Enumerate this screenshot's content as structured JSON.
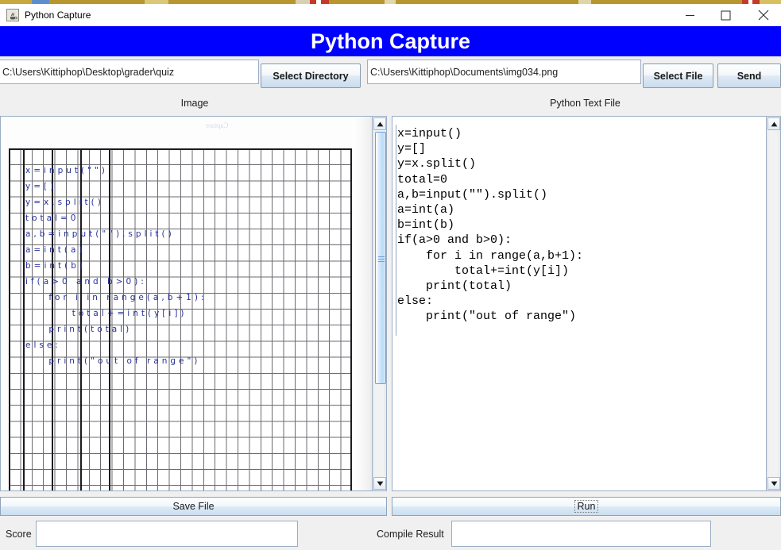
{
  "window": {
    "title": "Python Capture",
    "icon": "java-coffee-cup-icon",
    "controls": {
      "minimize": "—",
      "maximize": "□",
      "close": "✕"
    }
  },
  "banner": {
    "text": "Python Capture",
    "color": "#0000ff",
    "text_color": "#ffffff"
  },
  "toolbar": {
    "directory_path": "C:\\Users\\Kittiphop\\Desktop\\grader\\quiz",
    "select_directory_label": "Select Directory",
    "file_path": "C:\\Users\\Kittiphop\\Documents\\img034.png",
    "select_file_label": "Select File",
    "send_label": "Send"
  },
  "panels": {
    "image_caption": "Image",
    "python_caption": "Python Text File"
  },
  "image_panel": {
    "handwritten_lines": [
      "x=input(\"\")",
      "y=[]",
      "y=x.split()",
      "total=0",
      "a,b=input(\"\").split()",
      "a=int(a)",
      "b=int(b)",
      "if(a>0 and b>0):",
      "    for i in range(a,b+1):",
      "        total+=int(y[i])",
      "    print(total)",
      "else:",
      "    print(\"out of range\")"
    ],
    "ink_color": "#26309b"
  },
  "code_panel": {
    "text": "x=input()\ny=[]\ny=x.split()\ntotal=0\na,b=input(\"\").split()\na=int(a)\nb=int(b)\nif(a>0 and b>0):\n    for i in range(a,b+1):\n        total+=int(y[i])\n    print(total)\nelse:\n    print(\"out of range\")"
  },
  "actions": {
    "save_file_label": "Save File",
    "run_label": "Run"
  },
  "status": {
    "score_label": "Score",
    "score_value": "",
    "compile_label": "Compile Result",
    "compile_value": ""
  }
}
